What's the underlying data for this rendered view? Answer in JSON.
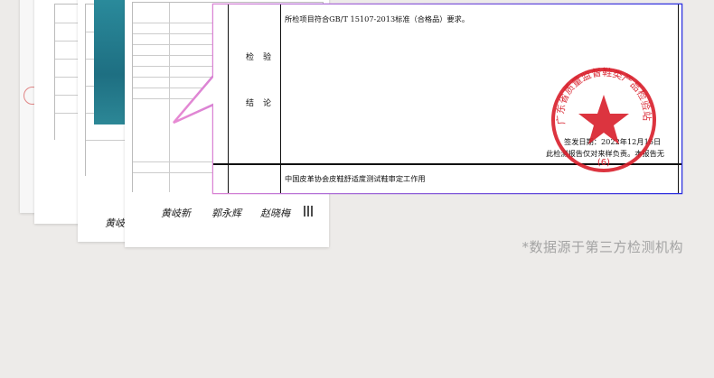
{
  "report": {
    "row_inspection_label": "检验",
    "row_conclusion_label": "结论",
    "conclusion_text": "所检项目符合GB/T 15107-2013标准（合格品）要求。",
    "sign_date_line": "签发日期：2022年12月16日",
    "notice_fragment": "此检测报告仅对来样负责。本报告无",
    "stamp_id": "(6)",
    "stamp_arc_text": "广东省质量监督鞋类产品检验站",
    "remarks_text": "中国皮革协会皮鞋舒适度测试鞋审定工作用"
  },
  "background_pages": {
    "sig_1": "黄岐新",
    "sig_2": "郭永辉",
    "sig_3": "赵晓梅"
  },
  "caption": "*数据源于第三方检测机构",
  "colors": {
    "background": "#edebe9",
    "callout_border_start": "#e88ad3",
    "callout_border_end": "#2a2ee0",
    "stamp_red": "#d81e2a",
    "caption_gray": "#a3a3a3"
  }
}
